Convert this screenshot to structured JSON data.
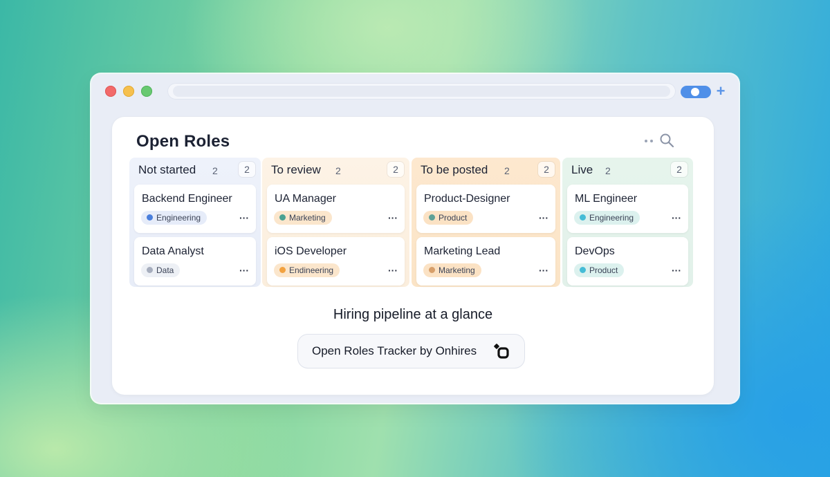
{
  "colors": {
    "toggle": "#4f8fe8",
    "plus": "#5b95e8"
  },
  "header": {
    "title": "Open Roles"
  },
  "columns": [
    {
      "title": "Not started",
      "count": "2",
      "badge": "2",
      "cards": [
        {
          "title": "Backend Engineer",
          "tag": "Engineering",
          "tag_color": "#4a7fdc",
          "tag_bg": "#e6ecf9"
        },
        {
          "title": "Data Analyst",
          "tag": "Data",
          "tag_color": "#a6adbd",
          "tag_bg": "#edf0f5"
        }
      ]
    },
    {
      "title": "To review",
      "count": "2",
      "badge": "2",
      "cards": [
        {
          "title": "UA Manager",
          "tag": "Marketing",
          "tag_color": "#4aa192",
          "tag_bg": "#fbe6cc"
        },
        {
          "title": "iOS Developer",
          "tag": "Endineering",
          "tag_color": "#f2a240",
          "tag_bg": "#fbe6cc"
        }
      ]
    },
    {
      "title": "To be posted",
      "count": "2",
      "badge": "2",
      "cards": [
        {
          "title": "Product-Designer",
          "tag": "Product",
          "tag_color": "#5fa197",
          "tag_bg": "#fbe2c4"
        },
        {
          "title": "Marketing Lead",
          "tag": "Marketing",
          "tag_color": "#d79f6a",
          "tag_bg": "#fbe2c4"
        }
      ]
    },
    {
      "title": "Live",
      "count": "2",
      "badge": "2",
      "cards": [
        {
          "title": "ML Engineer",
          "tag": "Engineering",
          "tag_color": "#45bcd6",
          "tag_bg": "#dcf1ee"
        },
        {
          "title": "DevOps",
          "tag": "Product",
          "tag_color": "#45bcd6",
          "tag_bg": "#dcf1ee"
        }
      ]
    }
  ],
  "icons": {
    "more": "···",
    "plus": "+"
  },
  "footer": {
    "subtitle": "Hiring pipeline at a glance",
    "cta_label": "Open Roles Tracker by Onhires"
  }
}
